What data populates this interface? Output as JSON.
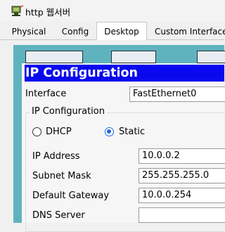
{
  "window": {
    "title": "http 웹서버",
    "icon": "router-pc-icon"
  },
  "tabs": [
    {
      "label": "Physical",
      "active": false
    },
    {
      "label": "Config",
      "active": false
    },
    {
      "label": "Desktop",
      "active": true
    },
    {
      "label": "Custom Interface",
      "active": false
    }
  ],
  "ip_config": {
    "title": "IP Configuration",
    "interface_label": "Interface",
    "interface_value": "FastEthernet0",
    "group_label": "IP Configuration",
    "dhcp_label": "DHCP",
    "static_label": "Static",
    "selected_mode": "Static",
    "ip_label": "IP Address",
    "ip_value": "10.0.0.2",
    "mask_label": "Subnet Mask",
    "mask_value": "255.255.255.0",
    "gateway_label": "Default Gateway",
    "gateway_value": "10.0.0.254",
    "dns_label": "DNS Server",
    "dns_value": ""
  },
  "colors": {
    "title_bar": "#0a08ee",
    "desktop_bg": "#5fb3bf",
    "radio_selected": "#1e6ad6"
  }
}
